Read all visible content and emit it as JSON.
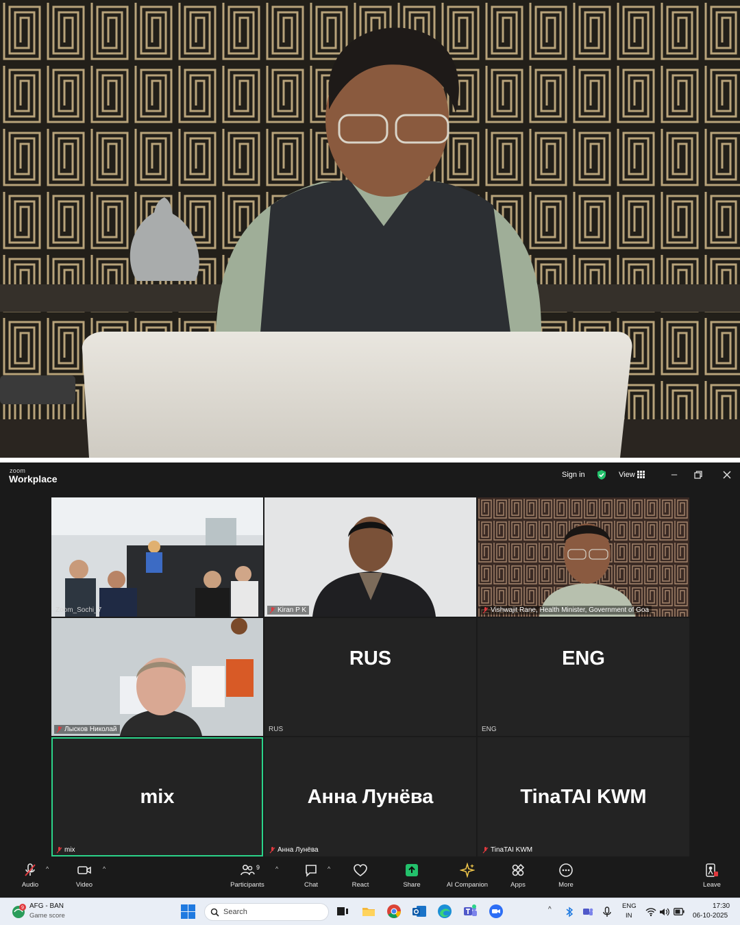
{
  "zoom": {
    "brand_small": "zoom",
    "brand": "Workplace",
    "sign_in": "Sign in",
    "view": "View",
    "tiles": [
      {
        "name": "Zoom_Sochi_7",
        "big": "",
        "type": "video"
      },
      {
        "name": "Kiran P K",
        "big": "",
        "type": "video"
      },
      {
        "name": "Vishwajit Rane, Health Minister, Government of Goa",
        "big": "",
        "type": "video"
      },
      {
        "name": "Лысков Николай",
        "big": "",
        "type": "video"
      },
      {
        "name": "RUS",
        "big": "RUS",
        "type": "label"
      },
      {
        "name": "ENG",
        "big": "ENG",
        "type": "label"
      },
      {
        "name": "mix",
        "big": "mix",
        "type": "label"
      },
      {
        "name": "Анна Лунёва",
        "big": "Анна Лунёва",
        "type": "label"
      },
      {
        "name": "TinaTAI KWM",
        "big": "TinaTAI KWM",
        "type": "label"
      }
    ],
    "toolbar": {
      "audio": "Audio",
      "video": "Video",
      "participants": "Participants",
      "participants_count": "9",
      "chat": "Chat",
      "react": "React",
      "share": "Share",
      "ai_companion": "AI Companion",
      "apps": "Apps",
      "more": "More",
      "leave": "Leave"
    },
    "colors": {
      "active_border": "#2bd48a",
      "share_green": "#23c16b",
      "mic_off_red": "#e0393e"
    }
  },
  "taskbar": {
    "weather_title": "AFG - BAN",
    "weather_subtitle": "Game score",
    "weather_badge": "9",
    "search_placeholder": "Search",
    "lang_top": "ENG",
    "lang_bottom": "IN",
    "time": "17:30",
    "date": "06-10-2025"
  }
}
